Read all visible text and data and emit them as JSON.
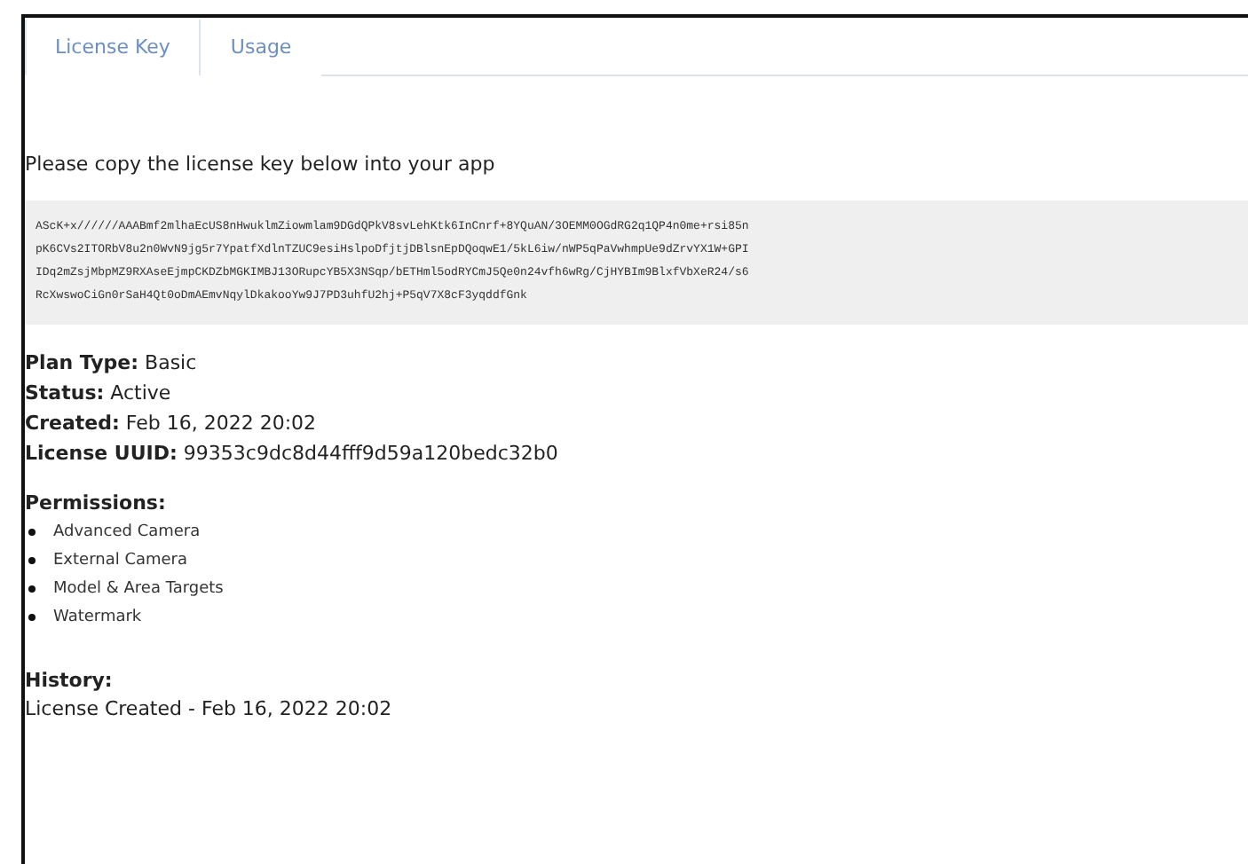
{
  "tabs": [
    {
      "label": "License Key",
      "selected": true
    },
    {
      "label": "Usage",
      "selected": false
    }
  ],
  "instruction": "Please copy the license key below into your app",
  "license_key": [
    "AScK+x//////AAABmf2mlhaEcUS8nHwuklmZiowmlam9DGdQPkV8svLehKtk6InCnrf+8YQuAN/3OEMM0OGdRG2q1QP4n0me+rsi85n",
    "pK6CVs2ITORbV8u2n0WvN9jg5r7YpatfXdlnTZUC9esiHslpoDfjtjDBlsnEpDQoqwE1/5kL6iw/nWP5qPaVwhmpUe9dZrvYX1W+GPI",
    "IDq2mZsjMbpMZ9RXAseEjmpCKDZbMGKIMBJ13ORupcYB5X3NSqp/bETHml5odRYCmJ5Qe0n24vfh6wRg/CjHYBIm9BlxfVbXeR24/s6",
    "RcXwswoCiGn0rSaH4Qt0oDmAEmvNqylDkakooYw9J7PD3uhfU2hj+P5qV7X8cF3yqddfGnk"
  ],
  "details": [
    "**Plan Type:** Basic",
    "**Status:** Active",
    "**Created:** Feb 16, 2022 20:02",
    "**License UUID:** 99353c9dc8d44fff9d59a120bedc32b0"
  ],
  "permissions": {
    "heading": "Permissions:",
    "items": [
      "Advanced Camera",
      "External Camera",
      "Model & Area Targets",
      "Watermark"
    ]
  },
  "history": {
    "heading": "History:",
    "items": [
      "License Created - Feb 16, 2022 20:02"
    ]
  }
}
